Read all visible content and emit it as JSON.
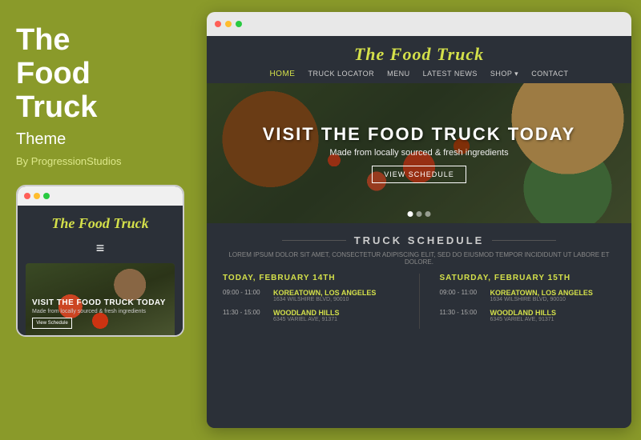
{
  "left": {
    "title_line1": "The",
    "title_line2": "Food",
    "title_line3": "Truck",
    "subtitle": "Theme",
    "byline": "By ProgressionStudios"
  },
  "mobile": {
    "logo": "The Food Truck",
    "hamburger": "≡",
    "hero_title": "VISIT THE FOOD TRUCK TODAY",
    "hero_sub": "Made from locally sourced & fresh ingredients",
    "hero_btn": "View Schedule"
  },
  "desktop": {
    "browser_dots": [
      "●",
      "●",
      "●"
    ],
    "site_title": "The Food Truck",
    "nav": {
      "home": "HOME",
      "truck_locator": "TRUCK LOCATOR",
      "menu": "MENU",
      "latest_news": "LATEST NEWS",
      "shop": "SHOP ▾",
      "contact": "CONTACT"
    },
    "hero": {
      "title": "VISIT THE FOOD TRUCK TODAY",
      "subtitle": "Made from locally sourced & fresh ingredients",
      "btn": "View Schedule"
    },
    "schedule": {
      "title": "TRUCK SCHEDULE",
      "subtitle": "LOREM IPSUM DOLOR SIT AMET, CONSECTETUR ADIPISCING ELIT, SED DO EIUSMOD TEMPOR INCIDIDUNT UT LABORE ET DOLORE.",
      "col1_header": "TODAY, FEBRUARY 14TH",
      "col2_header": "SATURDAY, FEBRUARY 15TH",
      "items1": [
        {
          "time": "09:00 - 11:00",
          "name": "KOREATOWN, LOS ANGELES",
          "addr": "1634 WILSHIRE BLVD, 90010"
        },
        {
          "time": "11:30 - 15:00",
          "name": "WOODLAND HILLS",
          "addr": "6345 VARIEL AVE, 91371"
        }
      ],
      "items2": [
        {
          "time": "09:00 - 11:00",
          "name": "KOREATOWN, LOS ANGELES",
          "addr": "1634 WILSHIRE BLVD, 90010"
        },
        {
          "time": "11:30 - 15:00",
          "name": "WOODLAND HILLS",
          "addr": "6345 VARIEL AVE, 91371"
        }
      ]
    }
  }
}
